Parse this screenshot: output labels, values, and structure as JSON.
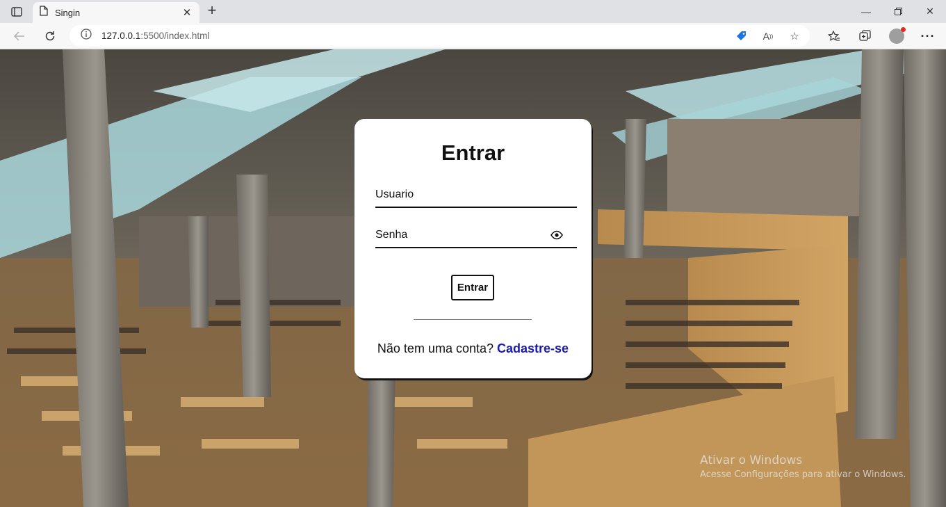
{
  "browser": {
    "tab_title": "Singin",
    "url_host": "127.0.0.1",
    "url_rest": ":5500/index.html"
  },
  "login": {
    "title": "Entrar",
    "username_placeholder": "Usuario",
    "password_placeholder": "Senha",
    "submit_label": "Entrar",
    "no_account_text": "Não tem uma conta?",
    "signup_link": "Cadastre-se"
  },
  "watermark": {
    "line1": "Ativar o Windows",
    "line2": "Acesse Configurações para ativar o Windows."
  },
  "colors": {
    "link": "#1a1ab5",
    "chrome_bg": "#dfe1e5",
    "toolbar_bg": "#f7f7f7"
  }
}
